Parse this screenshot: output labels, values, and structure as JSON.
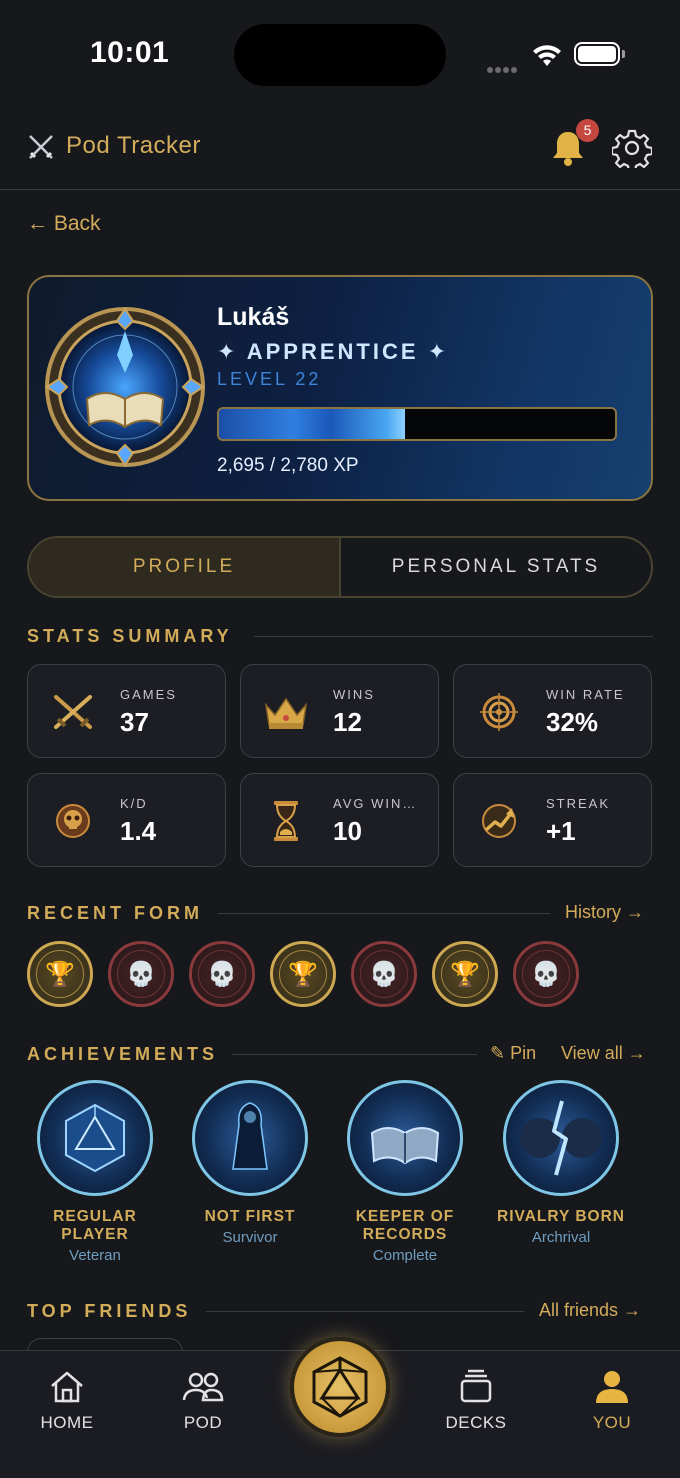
{
  "status_bar": {
    "time": "10:01"
  },
  "header": {
    "title": "Pod Tracker",
    "notification_count": "5"
  },
  "back_label": "← Back",
  "profile": {
    "name": "Lukáš",
    "rank": "✦ APPRENTICE ✦",
    "level": "LEVEL 22",
    "xp_text": "2,695 / 2,780 XP",
    "xp_progress_percent": 47
  },
  "tabs": [
    {
      "label": "PROFILE",
      "active": true
    },
    {
      "label": "PERSONAL STATS",
      "active": false
    }
  ],
  "stats_summary": {
    "title": "STATS SUMMARY",
    "items": [
      {
        "label": "GAMES",
        "value": "37",
        "icon": "crossed-swords-icon"
      },
      {
        "label": "WINS",
        "value": "12",
        "icon": "crown-icon"
      },
      {
        "label": "WIN RATE",
        "value": "32%",
        "icon": "target-icon"
      },
      {
        "label": "K/D",
        "value": "1.4",
        "icon": "skull-emblem-icon"
      },
      {
        "label": "AVG WIN…",
        "value": "10",
        "icon": "hourglass-icon"
      },
      {
        "label": "STREAK",
        "value": "+1",
        "icon": "trend-up-icon"
      }
    ]
  },
  "recent_form": {
    "title": "RECENT FORM",
    "link": "History →",
    "results": [
      "win",
      "loss",
      "loss",
      "win",
      "loss",
      "win",
      "loss"
    ],
    "win_glyph": "🏆",
    "loss_glyph": "💀"
  },
  "achievements": {
    "title": "ACHIEVEMENTS",
    "pin_label": "✎ Pin",
    "view_all_label": "View all →",
    "items": [
      {
        "name": "REGULAR PLAYER",
        "subtitle": "Veteran",
        "icon": "d20-die-icon"
      },
      {
        "name": "NOT FIRST",
        "subtitle": "Survivor",
        "icon": "hooded-figure-icon"
      },
      {
        "name": "KEEPER OF RECORDS",
        "subtitle": "Complete",
        "icon": "tome-icon"
      },
      {
        "name": "RIVALRY BORN",
        "subtitle": "Archrival",
        "icon": "lightning-rivals-icon"
      }
    ]
  },
  "top_friends": {
    "title": "TOP FRIENDS",
    "link": "All friends →"
  },
  "bottom_nav": {
    "items": [
      {
        "label": "HOME",
        "icon": "home-icon",
        "active": false
      },
      {
        "label": "POD",
        "icon": "people-icon",
        "active": false
      },
      {
        "label": "DECKS",
        "icon": "cards-stack-icon",
        "active": false
      },
      {
        "label": "YOU",
        "icon": "user-icon",
        "active": true
      }
    ],
    "center_icon": "d20-die-icon"
  },
  "colors": {
    "gold": "#d3ac5a",
    "background": "#17181c",
    "card": "#1d1e24",
    "loss_red": "#8a3a3c",
    "badge_red": "#c4483f"
  }
}
